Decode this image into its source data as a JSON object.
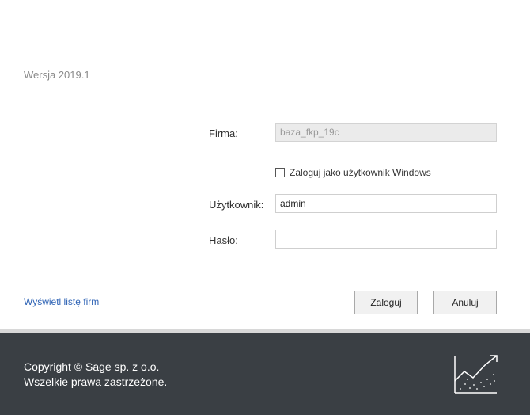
{
  "header": {
    "version": "Wersja 2019.1"
  },
  "form": {
    "company_label": "Firma:",
    "company_value": "baza_fkp_19c",
    "windows_login_label": "Zaloguj jako użytkownik Windows",
    "windows_login_checked": false,
    "user_label": "Użytkownik:",
    "user_value": "admin",
    "password_label": "Hasło:",
    "password_value": ""
  },
  "actions": {
    "show_companies_link": "Wyświetl listę firm",
    "login_button": "Zaloguj",
    "cancel_button": "Anuluj"
  },
  "footer": {
    "copyright_line1": "Copyright © Sage sp. z o.o.",
    "copyright_line2": "Wszelkie prawa zastrzeżone.",
    "logo_icon": "chart-trend-icon",
    "background": "#3a3f44"
  }
}
